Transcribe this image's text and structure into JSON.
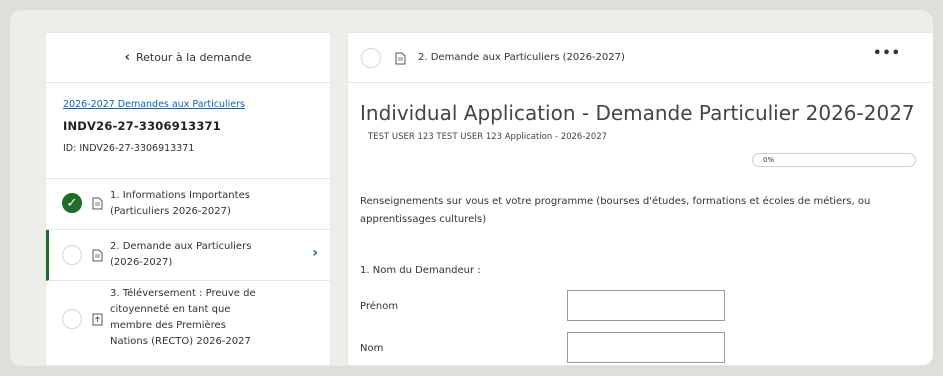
{
  "sidebar": {
    "back_label": "Retour à la demande",
    "form_link": "2026-2027 Demandes aux Particuliers",
    "application_code": "INDV26-27-3306913371",
    "application_id": "ID: INDV26-27-3306913371",
    "steps": [
      {
        "label_line1": "1. Informations Importantes",
        "label_line2": "(Particuliers 2026-2027)",
        "status": "complete"
      },
      {
        "label_line1": "2. Demande aux Particuliers",
        "label_line2": "(2026-2027)",
        "status": "current"
      },
      {
        "label_line1": "3. Téléversement : Preuve de",
        "label_line2": "citoyenneté en tant que",
        "label_line3": "membre des Premières",
        "label_line4": "Nations (RECTO) 2026-2027",
        "status": "incomplete"
      }
    ]
  },
  "main": {
    "header_title": "2. Demande aux Particuliers (2026-2027)",
    "more_label": "•••",
    "title": "Individual Application - Demande Particulier 2026-2027",
    "subtitle": "TEST USER 123 TEST USER 123   Application - 2026-2027",
    "progress_label": "0%",
    "progress_value": 0,
    "section_description": "Renseignements sur vous et votre programme (bourses d'études, formations et écoles de métiers, ou apprentissages culturels)",
    "question_label": "1. Nom du Demandeur :",
    "fields": [
      {
        "label": "Prénom",
        "value": ""
      },
      {
        "label": "Nom",
        "value": ""
      }
    ]
  },
  "colors": {
    "accent": "#1f6c2b",
    "link": "#0a63b5",
    "background": "#dedfda"
  }
}
